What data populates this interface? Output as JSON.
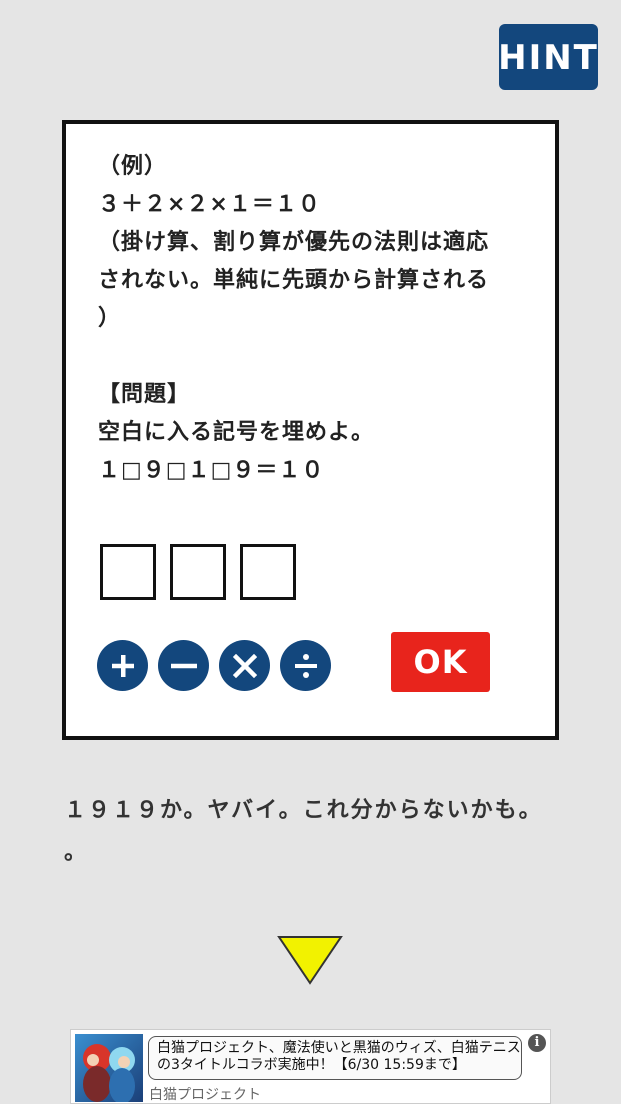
{
  "hint": {
    "label": "HINT",
    "color": "#13477d"
  },
  "card": {
    "lines": [
      "（例）",
      "３＋２×２×１＝１０",
      "（掛け算、割り算が優先の法則は適応",
      "されない。単純に先頭から計算される",
      "）",
      "",
      "【問題】",
      "空白に入る記号を埋めよ。",
      "１□９□１□９＝１０"
    ]
  },
  "operators": {
    "plus": "+",
    "minus": "−",
    "times": "×",
    "divide": "÷"
  },
  "ok": {
    "label": "OK",
    "color": "#e8241c"
  },
  "dialogue": {
    "lines": [
      "１９１９か。ヤバイ。これ分からないかも。",
      "。"
    ]
  },
  "next_arrow": {
    "icon": "down-triangle-icon",
    "color": "#f2f200"
  },
  "ad": {
    "lines": [
      "白猫プロジェクト、魔法使いと黒猫のウィズ、白猫テニス",
      "の3タイトルコラボ実施中！【6/30 15:59まで】"
    ],
    "source": "白猫プロジェクト",
    "info_icon": "i"
  }
}
